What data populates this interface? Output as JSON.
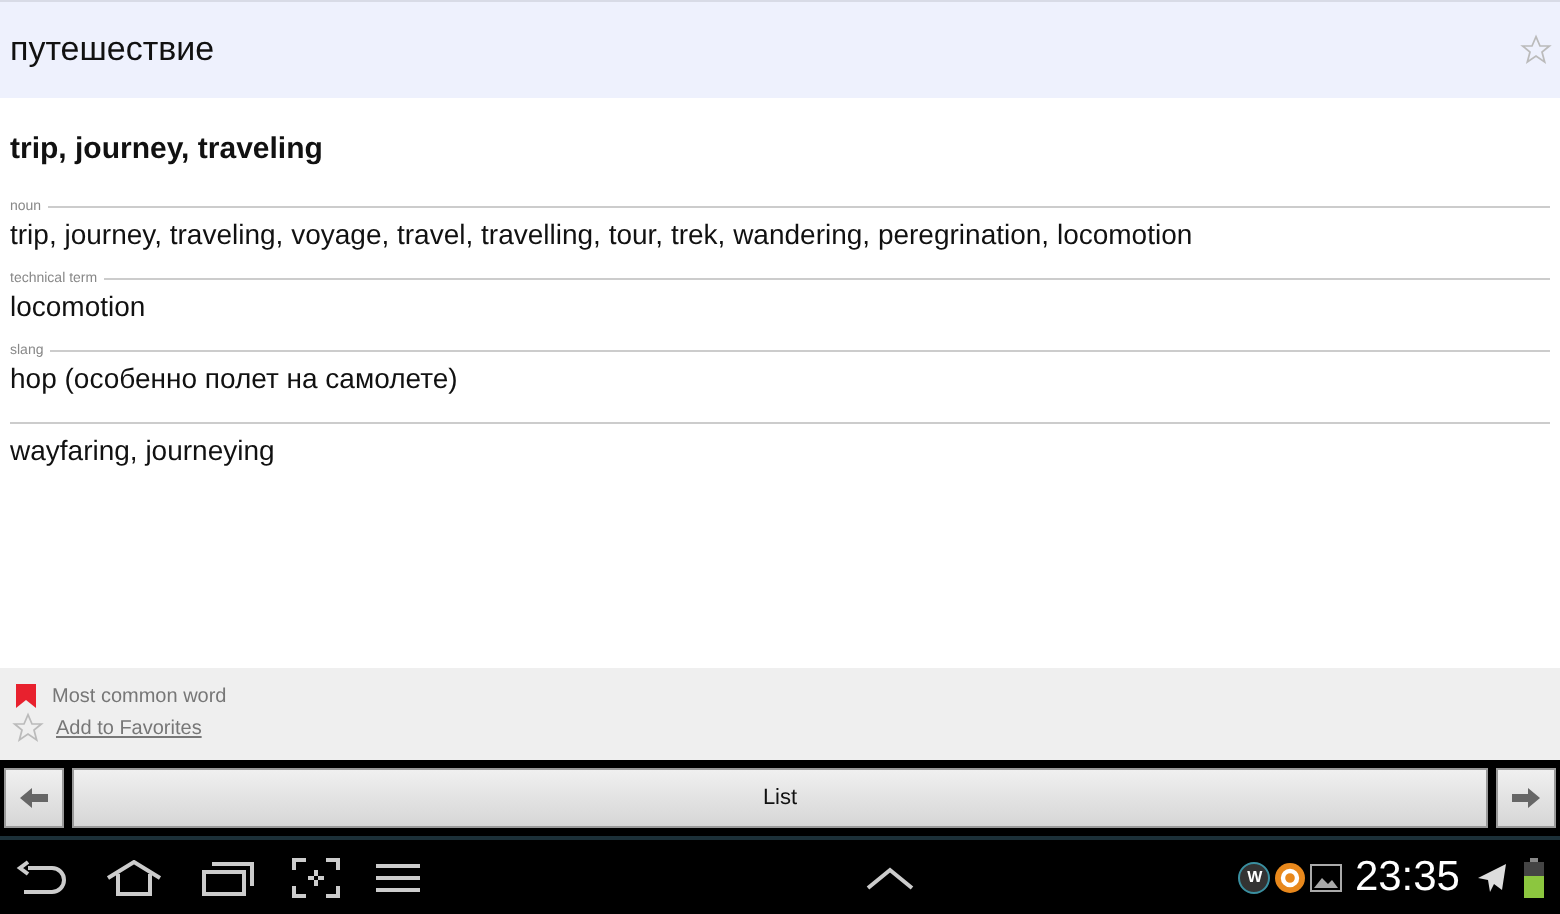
{
  "header": {
    "word": "путешествие",
    "favorite": false
  },
  "headline": "trip, journey, traveling",
  "sections": [
    {
      "label": "noun",
      "text": "trip, journey, traveling, voyage, travel, travelling, tour, trek, wandering, peregrination, locomotion"
    },
    {
      "label": "technical term",
      "text": "locomotion"
    },
    {
      "label": "slang",
      "text": "hop (особенно полет на самолете)"
    },
    {
      "text": "wayfaring, journeying"
    }
  ],
  "footer": {
    "common": "Most common word",
    "favorites_link": "Add to Favorites"
  },
  "nav": {
    "list_button": "List"
  },
  "status_bar": {
    "badge_letter": "W",
    "time": "23:35"
  }
}
